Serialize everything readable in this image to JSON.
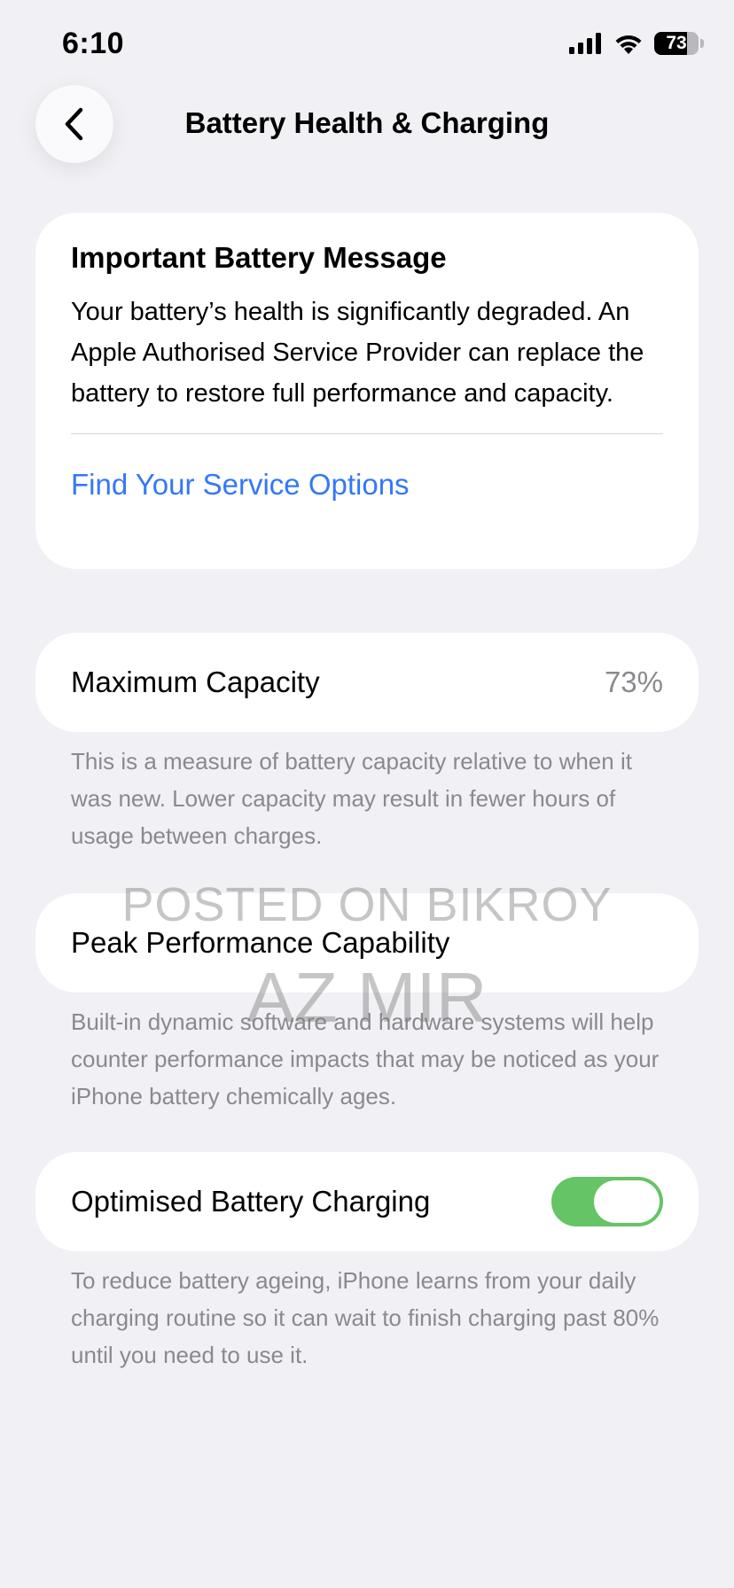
{
  "status_bar": {
    "time": "6:10",
    "battery_level": "73",
    "icons": [
      "cellular-signal-icon",
      "wifi-icon",
      "battery-icon"
    ]
  },
  "nav": {
    "back_icon": "chevron-left-icon",
    "title": "Battery Health & Charging"
  },
  "message_card": {
    "title": "Important Battery Message",
    "body": "Your battery’s health is significantly degraded. An Apple Authorised Service Provider can replace the battery to restore full performance and capacity.",
    "link": "Find Your Service Options",
    "link_color": "#3478f6"
  },
  "maximum_capacity": {
    "label": "Maximum Capacity",
    "value": "73%",
    "footnote": "This is a measure of battery capacity relative to when it was new. Lower capacity may result in fewer hours of usage between charges."
  },
  "peak_performance": {
    "label": "Peak Performance Capability",
    "footnote": "Built-in dynamic software and hardware systems will help counter performance impacts that may be noticed as your iPhone battery chemically ages."
  },
  "optimised_charging": {
    "label": "Optimised Battery Charging",
    "enabled": true,
    "toggle_color": "#65c466",
    "footnote": "To reduce battery ageing, iPhone learns from your daily charging routine so it can wait to finish charging past 80% until you need to use it."
  },
  "watermark": {
    "line1": "POSTED ON BIKROY",
    "line2": "AZ MIR"
  }
}
